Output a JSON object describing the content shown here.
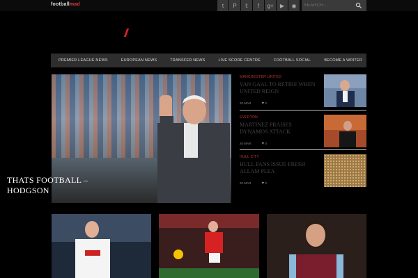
{
  "topbar": {
    "logo_prefix": "football",
    "logo_suffix": "mad",
    "social_icons": [
      "tumblr-icon",
      "pinterest-icon",
      "twitter-icon",
      "facebook-icon",
      "google-plus-icon",
      "youtube-icon",
      "rss-icon"
    ],
    "social_glyphs": [
      "t",
      "P",
      "𝕥",
      "f",
      "g+",
      "▶",
      "◉"
    ],
    "search_placeholder": "SEARCH..."
  },
  "nav": {
    "items": [
      "PREMIER LEAGUE NEWS",
      "EUROPEAN NEWS",
      "TRANSFER NEWS",
      "LIVE SCORE CENTRE",
      "FOOTBALL SOCIAL",
      "BECOME A WRITER"
    ]
  },
  "hero": {
    "title_line1": "THATS FOOTBALL –",
    "title_line2": "HODGSON"
  },
  "stories": [
    {
      "category": "MANCHESTER UNITED",
      "title": "VAN GAAL TO RETIRE WHEN UNITED REIGN",
      "date": "20 MAR",
      "likes": "0"
    },
    {
      "category": "EVERTON",
      "title": "MARTINEZ PRAISES DYNAMOS ATTACK",
      "date": "20 MAR",
      "likes": "0"
    },
    {
      "category": "HULL CITY",
      "title": "HULL FANS ISSUE FRESH ALLAM PLEA",
      "date": "20 MAR",
      "likes": "0"
    }
  ],
  "colors": {
    "accent": "#c0392b",
    "nav_bg": "#2e2e2e",
    "topbar_bg": "#0b0b0b"
  }
}
